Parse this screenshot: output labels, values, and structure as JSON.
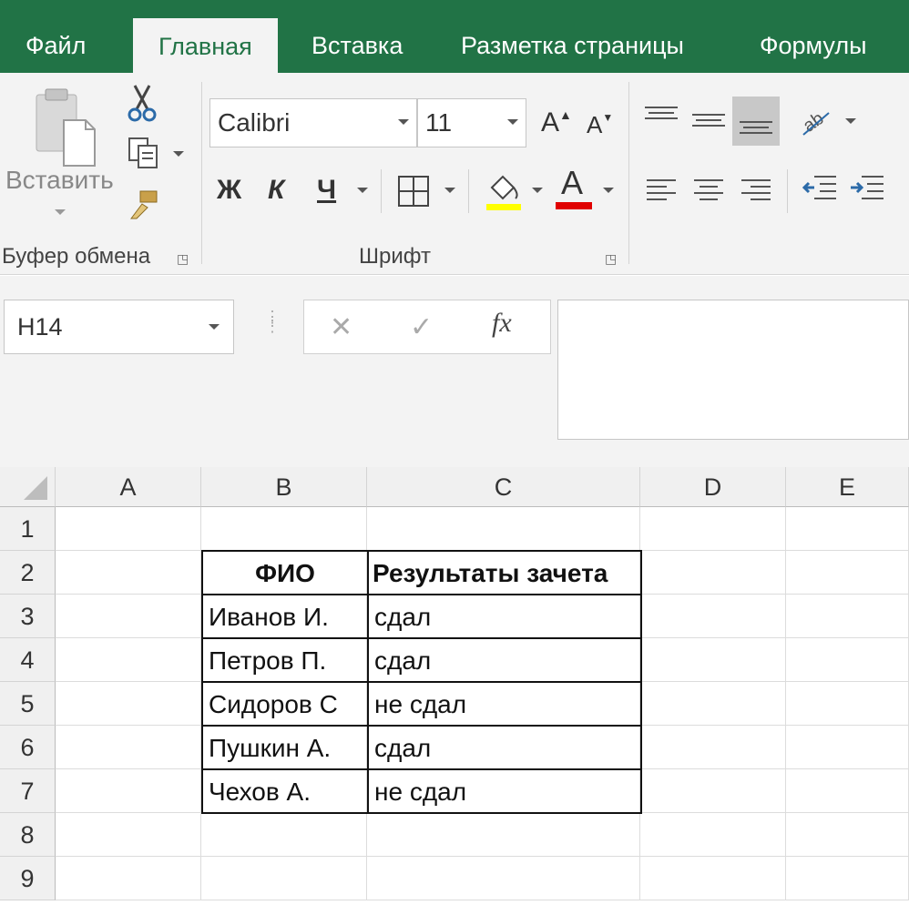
{
  "tabs": [
    {
      "label": "Файл",
      "active": false
    },
    {
      "label": "Главная",
      "active": true
    },
    {
      "label": "Вставка",
      "active": false
    },
    {
      "label": "Разметка страницы",
      "active": false
    },
    {
      "label": "Формулы",
      "active": false
    }
  ],
  "ribbon": {
    "clipboard": {
      "paste_label": "Вставить",
      "group_label": "Буфер обмена"
    },
    "font": {
      "font_name": "Calibri",
      "font_size": "11",
      "bold_label": "Ж",
      "italic_label": "К",
      "underline_label": "Ч",
      "font_color_letter": "A",
      "grow_label": "A",
      "shrink_label": "A",
      "group_label": "Шрифт",
      "fill_color": "#ffff00",
      "font_color": "#e00000"
    }
  },
  "formula_bar": {
    "name_box": "H14",
    "fx_label": "fx",
    "formula": ""
  },
  "grid": {
    "columns": [
      "A",
      "B",
      "C",
      "D",
      "E"
    ],
    "rows": [
      "1",
      "2",
      "3",
      "4",
      "5",
      "6",
      "7",
      "8",
      "9"
    ],
    "table": {
      "headers": [
        "ФИО",
        "Результаты зачета"
      ],
      "rows": [
        [
          "Иванов И.",
          "сдал"
        ],
        [
          "Петров П.",
          "сдал"
        ],
        [
          "Сидоров С",
          "не сдал"
        ],
        [
          "Пушкин А.",
          "сдал"
        ],
        [
          "Чехов А.",
          "не сдал"
        ]
      ]
    }
  },
  "colors": {
    "accent": "#217346"
  }
}
